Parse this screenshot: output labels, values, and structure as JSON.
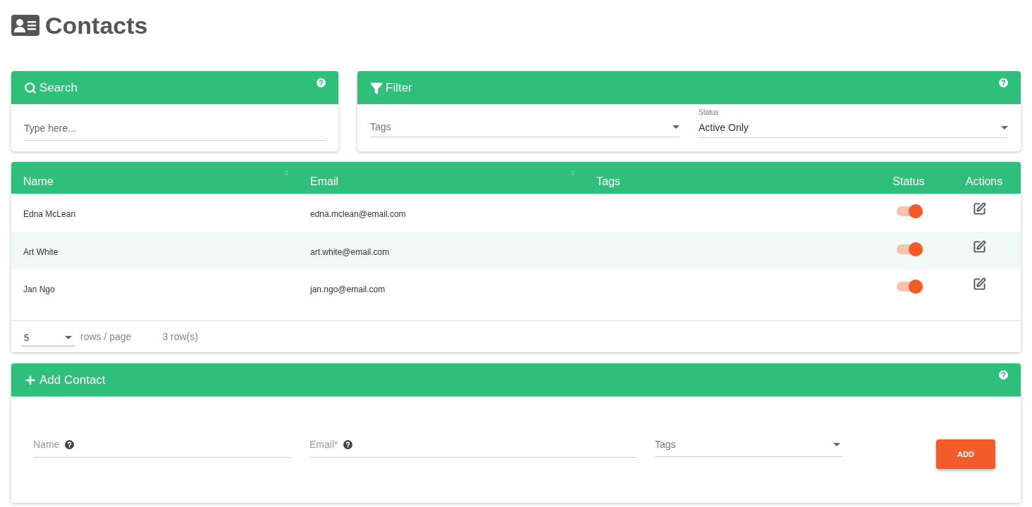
{
  "page": {
    "title": "Contacts"
  },
  "search": {
    "title": "Search",
    "placeholder": "Type here..."
  },
  "filter": {
    "title": "Filter",
    "tags": {
      "placeholder": "Tags"
    },
    "status": {
      "label": "Status",
      "value": "Active Only"
    }
  },
  "table": {
    "columns": [
      {
        "label": "Name",
        "sortable": true
      },
      {
        "label": "Email",
        "sortable": true
      },
      {
        "label": "Tags",
        "sortable": false
      },
      {
        "label": "Status",
        "sortable": false
      },
      {
        "label": "Actions",
        "sortable": false
      }
    ],
    "rows": [
      {
        "name": "Edna McLean",
        "email": "edna.mclean@email.com",
        "active": true
      },
      {
        "name": "Art White",
        "email": "art.white@email.com",
        "active": true
      },
      {
        "name": "Jan Ngo",
        "email": "jan.ngo@email.com",
        "active": true
      }
    ],
    "pager": {
      "page_size": "5",
      "rows_per_page_label": "rows / page",
      "count": "3 row(s)"
    }
  },
  "add_contact": {
    "title": "Add Contact",
    "name": {
      "placeholder": "Name"
    },
    "email": {
      "placeholder": "Email*"
    },
    "tags": {
      "placeholder": "Tags"
    },
    "button": "ADD"
  }
}
